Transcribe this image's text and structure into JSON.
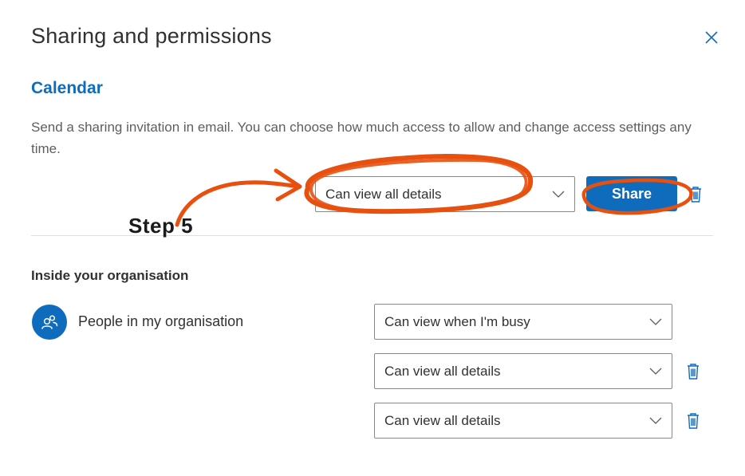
{
  "dialog": {
    "title": "Sharing and permissions",
    "section_title": "Calendar",
    "description": "Send a sharing invitation in email. You can choose how much access to allow and change access settings any time.",
    "invite_permission": "Can view all details",
    "share_label": "Share"
  },
  "annotation": {
    "step_label": "Step 5",
    "color": "#e8500f"
  },
  "organisation": {
    "heading": "Inside your organisation",
    "entries": [
      {
        "name": "People in my organisation",
        "permission": "Can view when I'm busy"
      },
      {
        "name": "",
        "permission": "Can view all details"
      },
      {
        "name": "",
        "permission": "Can view all details"
      }
    ]
  },
  "colors": {
    "accent": "#0f6cbd",
    "text": "#323130",
    "muted": "#605e5c"
  },
  "icons": {
    "close": "close-icon",
    "chevron": "chevron-down-icon",
    "trash": "trash-icon",
    "people": "people-icon"
  }
}
